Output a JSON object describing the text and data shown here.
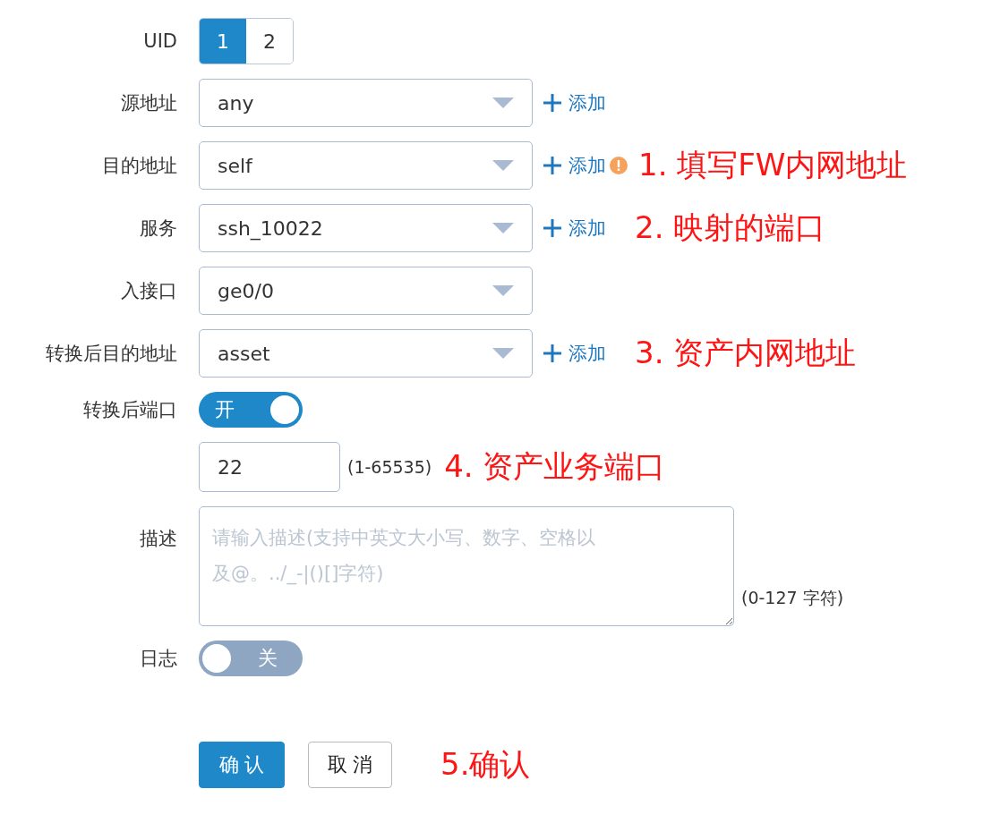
{
  "fields": [
    {
      "kind": "segmented",
      "label": "UID",
      "options": [
        {
          "label": "1",
          "selected": true
        },
        {
          "label": "2",
          "selected": false
        }
      ]
    },
    {
      "kind": "select",
      "label": "源地址",
      "value": "any",
      "add": "添加"
    },
    {
      "kind": "select",
      "label": "目的地址",
      "value": "self",
      "add": "添加",
      "warning": true,
      "annotation": "1. 填写FW内网地址"
    },
    {
      "kind": "select",
      "label": "服务",
      "value": "ssh_10022",
      "add": "添加",
      "annotation": "2. 映射的端口"
    },
    {
      "kind": "select",
      "label": "入接口",
      "value": "ge0/0"
    },
    {
      "kind": "select",
      "label": "转换后目的地址",
      "value": "asset",
      "add": "添加",
      "annotation": "3. 资产内网地址"
    },
    {
      "kind": "toggle",
      "label": "转换后端口",
      "on": true,
      "text": "开"
    },
    {
      "kind": "number",
      "value": "22",
      "range": "(1-65535)",
      "annotation": "4. 资产业务端口"
    },
    {
      "kind": "textarea",
      "label": "描述",
      "placeholder": "请输入描述(支持中英文大小写、数字、空格以及@。../_-|()[]字符)",
      "limit": "(0-127 字符)"
    },
    {
      "kind": "toggle",
      "label": "日志",
      "on": false,
      "text": "关"
    }
  ],
  "buttons": [
    {
      "label": "确 认",
      "kind": "primary"
    },
    {
      "label": "取 消",
      "kind": "default"
    }
  ],
  "button_annotation": "5.确认"
}
